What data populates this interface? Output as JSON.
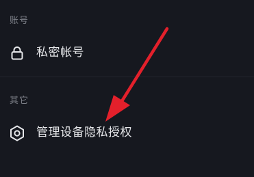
{
  "sections": [
    {
      "title": "账号",
      "items": [
        {
          "label": "私密帐号",
          "icon": "lock-icon"
        }
      ]
    },
    {
      "title": "其它",
      "items": [
        {
          "label": "管理设备隐私授权",
          "icon": "hexagon-settings-icon"
        }
      ]
    }
  ],
  "colors": {
    "background": "#16181f",
    "section_label": "#7d8088",
    "item_text": "#e6e7ea",
    "arrow": "#e3202b"
  }
}
